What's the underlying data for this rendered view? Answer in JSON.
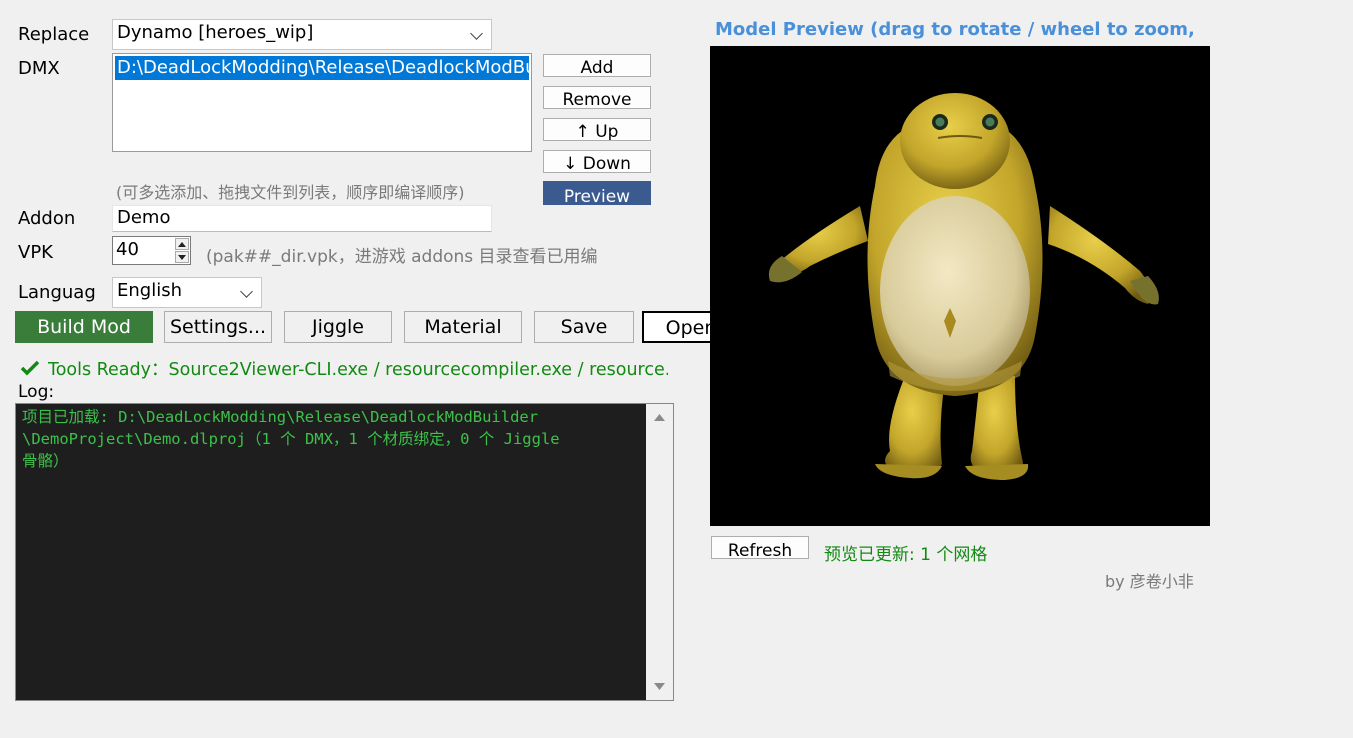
{
  "form": {
    "replace_label": "Replace",
    "replace_value": "Dynamo  [heroes_wip]",
    "dmx_label": "DMX",
    "dmx_items": [
      "D:\\DeadLockModding\\Release\\DeadlockModBu"
    ],
    "dmx_hint": "(可多选添加、拖拽文件到列表，顺序即编译顺序)",
    "addon_label": "Addon",
    "addon_value": "Demo",
    "vpk_label": "VPK",
    "vpk_value": "40",
    "vpk_hint": "(pak##_dir.vpk，进游戏 addons 目录查看已用编",
    "language_label": "Languag",
    "language_value": "English"
  },
  "dmx_buttons": {
    "add": "Add",
    "remove": "Remove",
    "up": "↑ Up",
    "down": "↓ Down",
    "preview": "Preview"
  },
  "toolbar": {
    "build": "Build Mod",
    "settings": "Settings...",
    "jiggle": "Jiggle",
    "material": "Material",
    "save": "Save",
    "open": "Open"
  },
  "status": {
    "text": "Tools Ready：Source2Viewer-CLI.exe / resourcecompiler.exe / resource..."
  },
  "log": {
    "label": "Log:",
    "lines": [
      "项目已加载: D:\\DeadLockModding\\Release\\DeadlockModBuilder",
      "\\DemoProject\\Demo.dlproj（1 个 DMX，1 个材质绑定，0 个 Jiggle",
      "骨骼）"
    ]
  },
  "preview": {
    "title": "Model Preview (drag to rotate / wheel to zoom,",
    "refresh": "Refresh",
    "status": "预览已更新: 1 个网格",
    "credit": "by 彦卷小非"
  },
  "colors": {
    "accent_blue": "#4a90d9",
    "build_green": "#3a7d3a",
    "preview_button": "#3b5a8f",
    "status_green": "#128a12",
    "log_green": "#3cc24a"
  }
}
